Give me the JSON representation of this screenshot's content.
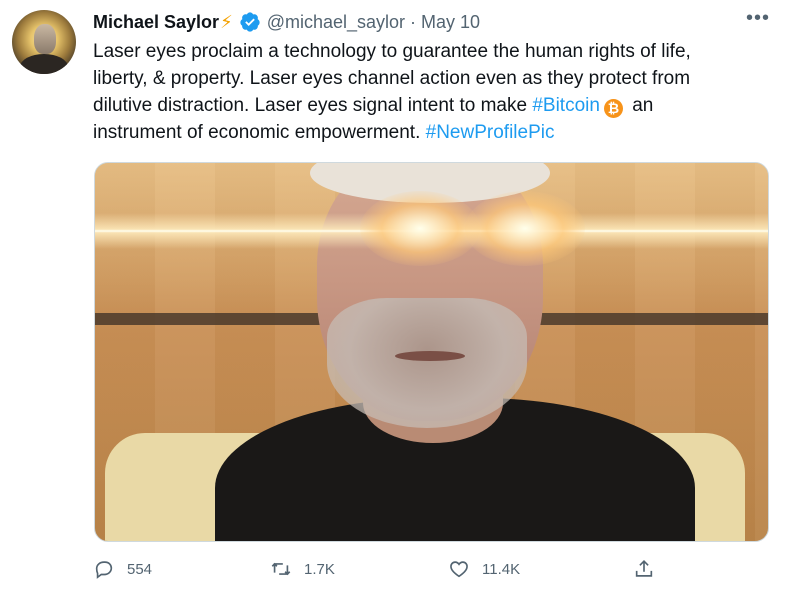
{
  "author": {
    "name": "Michael Saylor",
    "emoji_badge": "⚡",
    "verified": true,
    "handle": "@michael_saylor",
    "separator": "·",
    "date": "May 10"
  },
  "tweet": {
    "line1": "Laser eyes proclaim a technology to guarantee the human rights of life,",
    "line2": "liberty, & property.  Laser eyes channel action even as they protect from",
    "line3_pre": "dilutive distraction.  Laser eyes signal intent to make ",
    "line3_hashtag": "#Bitcoin",
    "line3_post": " an",
    "line4_pre": "instrument of economic empowerment.  ",
    "line4_hashtag": "#NewProfilePic",
    "btc_symbol": "₿"
  },
  "more_menu": "•••",
  "actions": {
    "reply_count": "554",
    "retweet_count": "1.7K",
    "like_count": "11.4K"
  },
  "colors": {
    "link": "#1d9bf0",
    "muted": "#536471",
    "bitcoin": "#f7931a",
    "bolt": "#f4a100"
  },
  "icons": [
    "reply-icon",
    "retweet-icon",
    "like-icon",
    "share-icon",
    "verified-badge-icon",
    "more-icon"
  ]
}
